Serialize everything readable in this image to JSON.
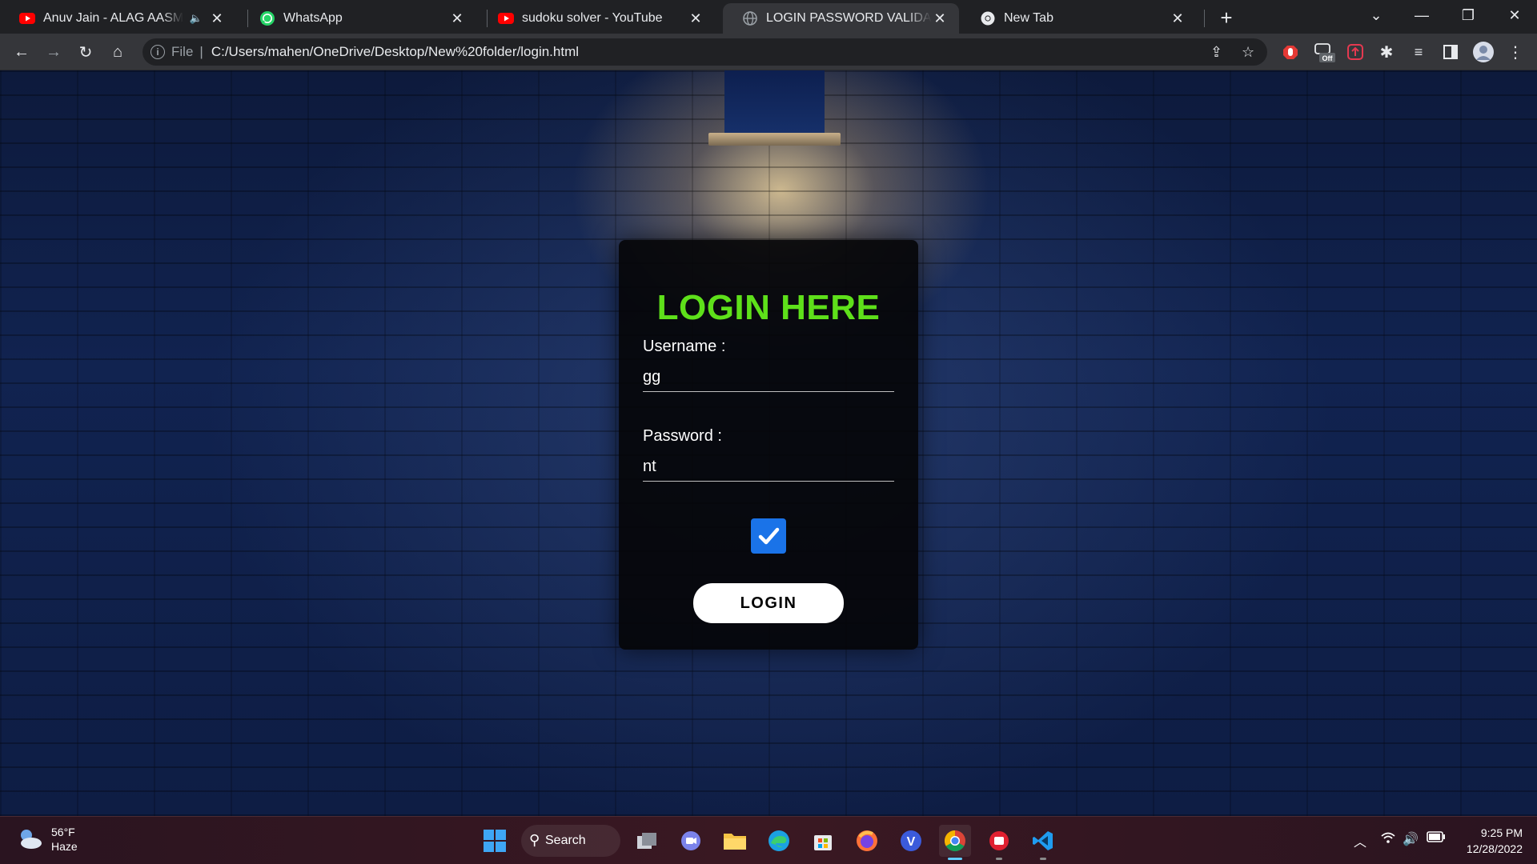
{
  "browser": {
    "tabs": [
      {
        "title": "Anuv Jain - ALAG AASMAAN",
        "favicon": "youtube-icon",
        "audio": true,
        "active": false
      },
      {
        "title": "WhatsApp",
        "favicon": "whatsapp-icon",
        "active": false
      },
      {
        "title": "sudoku solver - YouTube",
        "favicon": "youtube-icon",
        "active": false
      },
      {
        "title": "LOGIN PASSWORD VALIDATION",
        "favicon": "globe-icon",
        "active": true
      },
      {
        "title": "New Tab",
        "favicon": "chrome-icon",
        "active": false
      }
    ],
    "address": {
      "scheme": "File",
      "url": "C:/Users/mahen/OneDrive/Desktop/New%20folder/login.html"
    },
    "extensions": [
      "adblock-icon",
      "off-badge-icon",
      "upload-ext-icon",
      "puzzle-icon",
      "media-queue-icon",
      "sidepanel-icon",
      "profile-avatar-icon",
      "kebab-menu-icon"
    ],
    "extension_badge": "Off"
  },
  "login": {
    "heading": "LOGIN HERE",
    "username_label": "Username :",
    "username_value": "gg",
    "password_label": "Password :",
    "password_value": "nt",
    "checkbox_checked": true,
    "button_label": "LOGIN",
    "heading_color": "#5ee01a"
  },
  "taskbar": {
    "weather_temp": "56°F",
    "weather_desc": "Haze",
    "search_label": "Search",
    "time": "9:25 PM",
    "date": "12/28/2022",
    "pinned": [
      "windows-start-icon",
      "task-view-icon",
      "teams-icon",
      "file-explorer-icon",
      "edge-icon",
      "store-icon",
      "firefox-icon",
      "vivaldi-icon",
      "chrome-icon",
      "app-red-icon",
      "vscode-icon"
    ]
  }
}
